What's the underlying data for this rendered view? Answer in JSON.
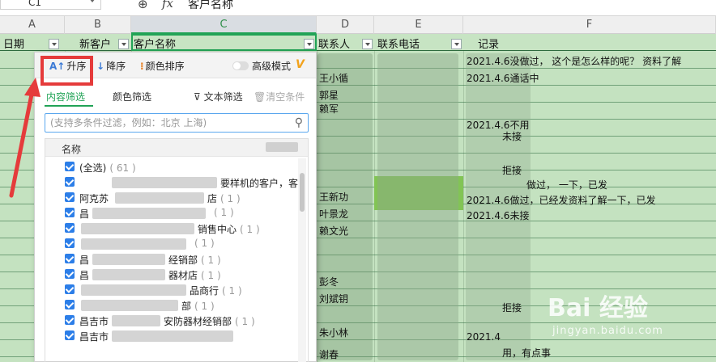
{
  "formula_bar": {
    "cell_ref": "C1",
    "fx": "fx",
    "content": "客户名称"
  },
  "columns": [
    "A",
    "B",
    "C",
    "D",
    "E",
    "F"
  ],
  "header_row": {
    "date": "日期",
    "new_customer": "新客户",
    "customer_name": "客户名称",
    "contact": "联系人",
    "phone": "联系电话",
    "record": "记录"
  },
  "cells": {
    "d_rows": [
      "王小循",
      "郭星",
      "赖军",
      "王新功",
      "叶景龙",
      "赖文光",
      "彭冬",
      "刘斌钥",
      "朱小林",
      "谢春"
    ],
    "f_rows": [
      "2021.4.6没做过，    这个是怎么样的呢？ 资料了解",
      "2021.4.6通话中",
      "2021.4.6不用",
      "做过，         一下，已发",
      "2021.4.6做过，已经发资料了解一下，已发",
      "2021.4.6未接",
      "未接",
      "拒接",
      "拒接",
      "2021.4",
      "用，有点事"
    ]
  },
  "filter_popup": {
    "toolbar": {
      "sort_asc": "升序",
      "sort_desc": "降序",
      "color_sort": "颜色排序",
      "advanced_mode": "高级模式",
      "advanced_badge": "V"
    },
    "tabs": {
      "content_filter": "内容筛选",
      "color_filter": "颜色筛选",
      "text_filter": "文本筛选",
      "clear_condition": "清空条件"
    },
    "search": {
      "placeholder": "(支持多条件过滤，例如：北京 上海)"
    },
    "list": {
      "header_label": "名称",
      "items": [
        {
          "text": "(全选)",
          "count": "( 61 )"
        },
        {
          "text": "要样机的客户，客",
          "count": ""
        },
        {
          "text": "阿克苏",
          "count": "( 1 )",
          "suffix": "店"
        },
        {
          "text": "昌",
          "count": "( 1 )"
        },
        {
          "text": "",
          "count": "( 1 )",
          "suffix": "销售中心"
        },
        {
          "text": "",
          "count": "( 1 )"
        },
        {
          "text": "昌",
          "count": "( 1 )",
          "suffix": "经销部"
        },
        {
          "text": "昌",
          "count": "( 1 )",
          "suffix": "器材店"
        },
        {
          "text": "",
          "count": "( 1 )",
          "suffix": "品商行"
        },
        {
          "text": "",
          "count": "( 1 )",
          "suffix": "部"
        },
        {
          "text": "昌吉市",
          "count": "( 1 )",
          "suffix": "安防器材经销部"
        },
        {
          "text": "昌吉市",
          "count": "( 1 )"
        }
      ]
    }
  },
  "watermark": {
    "logo": "Bai 经验",
    "url": "jingyan.baidu.com"
  },
  "colors": {
    "grid_green": "#c4e2c0",
    "accent_green": "#21a356",
    "highlight_red": "#e53b3b",
    "checkbox_blue": "#2c7ee8"
  }
}
